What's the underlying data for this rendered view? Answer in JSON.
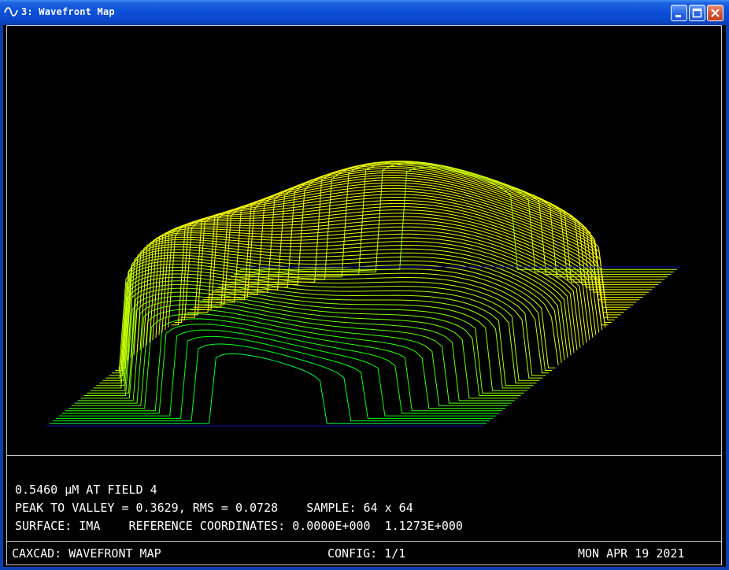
{
  "window": {
    "title": "3: Wavefront Map",
    "colors": {
      "titlebar": "#0b4fd8",
      "close": "#d1512f"
    },
    "icons": [
      "sine-wave-icon",
      "minimize-icon",
      "maximize-icon",
      "close-icon"
    ]
  },
  "info": {
    "line1": "0.5460 µM AT FIELD 4",
    "line2": "PEAK TO VALLEY = 0.3629, RMS = 0.0728    SAMPLE: 64 x 64",
    "line3": "SURFACE: IMA    REFERENCE COORDINATES: 0.0000E+000  1.1273E+000"
  },
  "status": {
    "left": "CAXCAD: WAVEFRONT MAP",
    "center": "CONFIG: 1/1",
    "right": "MON APR 19 2021"
  },
  "plot": {
    "type": "3d-wireframe-surface",
    "colormap": [
      "#0000ff",
      "#00ffff",
      "#00ff00",
      "#ffff00",
      "#ff0000"
    ]
  }
}
